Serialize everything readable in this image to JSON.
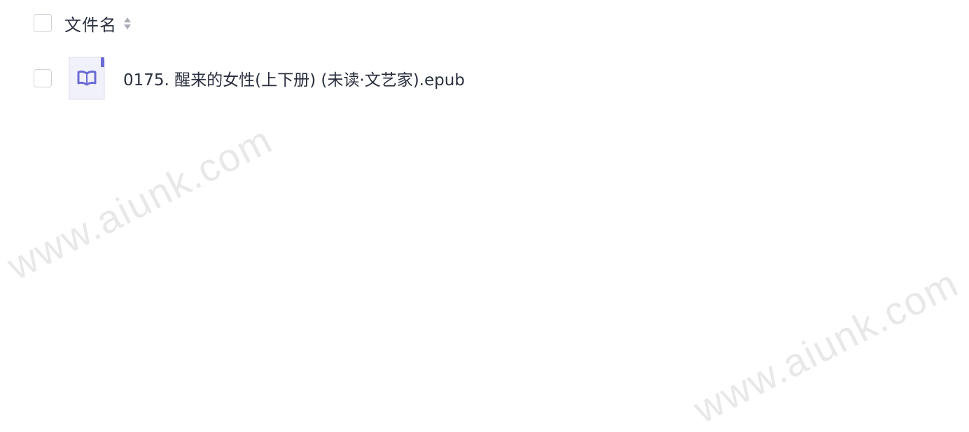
{
  "header": {
    "column_title": "文件名",
    "sort_icon": "sort-icon"
  },
  "files": [
    {
      "name": "0175. 醒来的女性(上下册) (未读·文艺家).epub",
      "icon": "book-file-icon"
    }
  ],
  "watermark": {
    "text": "www.aiunk.com"
  },
  "colors": {
    "text": "#2a2f3f",
    "checkbox_border": "#cfd2d9",
    "file_icon_bg": "#f1f1fb",
    "file_icon_accent": "#6b6bd6",
    "watermark": "#d9d9d9"
  }
}
